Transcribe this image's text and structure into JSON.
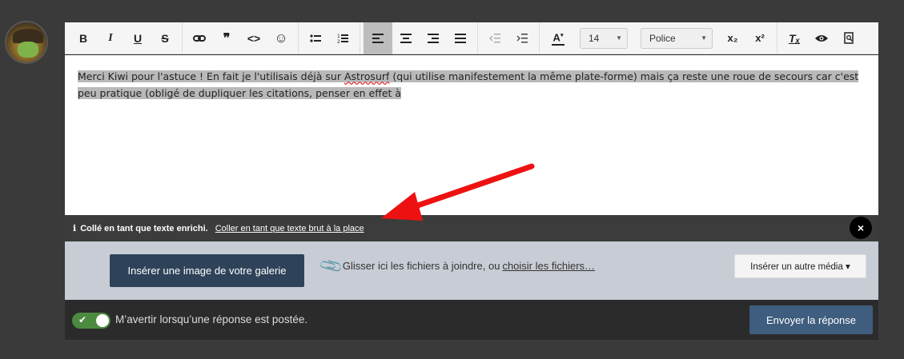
{
  "editor": {
    "text_before_spell": "Merci Kiwi pour l'astuce ! En fait je l'utilisais déjà sur ",
    "spell_word": "Astrosurf",
    "text_after_spell": " (qui utilise manifestement la même plate-forme) mais ça reste une roue de secours car c'est",
    "line2": "peu pratique (obligé de dupliquer les citations, penser en effet à"
  },
  "toolbar": {
    "bold": "B",
    "italic": "I",
    "underline": "U",
    "strike": "S",
    "link_icon": "link-icon",
    "quote": "❞",
    "code": "<>",
    "smiley": "☺",
    "font_size": "14",
    "font_family": "Police",
    "subscript": "x₂",
    "superscript": "x²",
    "clear_format": "Tₓ",
    "preview": "👁"
  },
  "paste_bar": {
    "message": "Collé en tant que texte enrichi.",
    "link": "Coller en tant que texte brut à la place",
    "close": "×"
  },
  "upload": {
    "gallery_button": "Insérer une image de votre galerie",
    "drop_text": "Glisser ici les fichiers à joindre, ou",
    "choose_link": "choisir les fichiers…",
    "media_button": "Insérer un autre média ▾"
  },
  "footer": {
    "notify_label": "M’avertir lorsqu’une réponse est postée.",
    "send_button": "Envoyer la réponse"
  },
  "colors": {
    "gallery_button": "#2e4359",
    "send_button": "#3f5d7e",
    "toggle_on": "#4c8a3f",
    "arrow": "#ee1111"
  }
}
